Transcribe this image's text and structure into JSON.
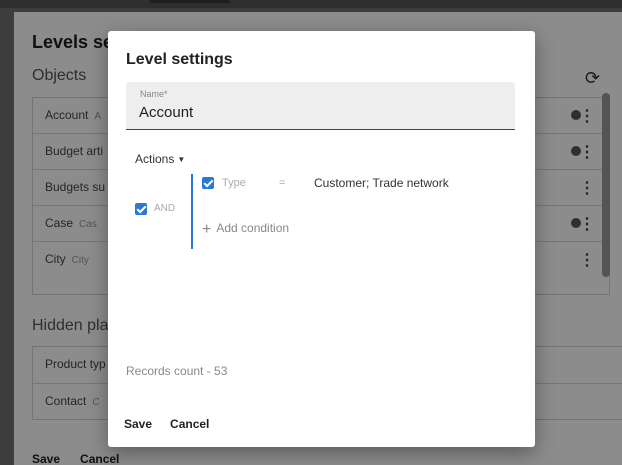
{
  "background": {
    "title": "Levels se",
    "section_objects": "Objects",
    "objects": [
      {
        "name": "Account",
        "sub": "A",
        "dot": true
      },
      {
        "name": "Budget arti",
        "sub": "",
        "dot": true
      },
      {
        "name": "Budgets su",
        "sub": "",
        "dot": false
      },
      {
        "name": "Case",
        "sub": "Cas",
        "dot": true
      },
      {
        "name": "City",
        "sub": "City",
        "dot": false
      }
    ],
    "section_hidden": "Hidden pla",
    "hidden_items": [
      {
        "name": "Product typ",
        "sub": ""
      },
      {
        "name": "Contact",
        "sub": "C"
      }
    ],
    "save_label": "Save",
    "cancel_label": "Cancel",
    "refresh_icon": "refresh-icon",
    "kebab_icon": "more-vert-icon"
  },
  "dialog": {
    "title": "Level settings",
    "name_label": "Name*",
    "name_value": "Account",
    "actions_label": "Actions",
    "group_operator": "AND",
    "condition": {
      "field": "Type",
      "operator": "=",
      "value": "Customer; Trade network"
    },
    "add_condition_label": "Add condition",
    "records_count": "Records count - 53",
    "save_label": "Save",
    "cancel_label": "Cancel"
  },
  "colors": {
    "accent": "#2979d2",
    "overlay": "rgba(0,0,0,0.45)"
  }
}
